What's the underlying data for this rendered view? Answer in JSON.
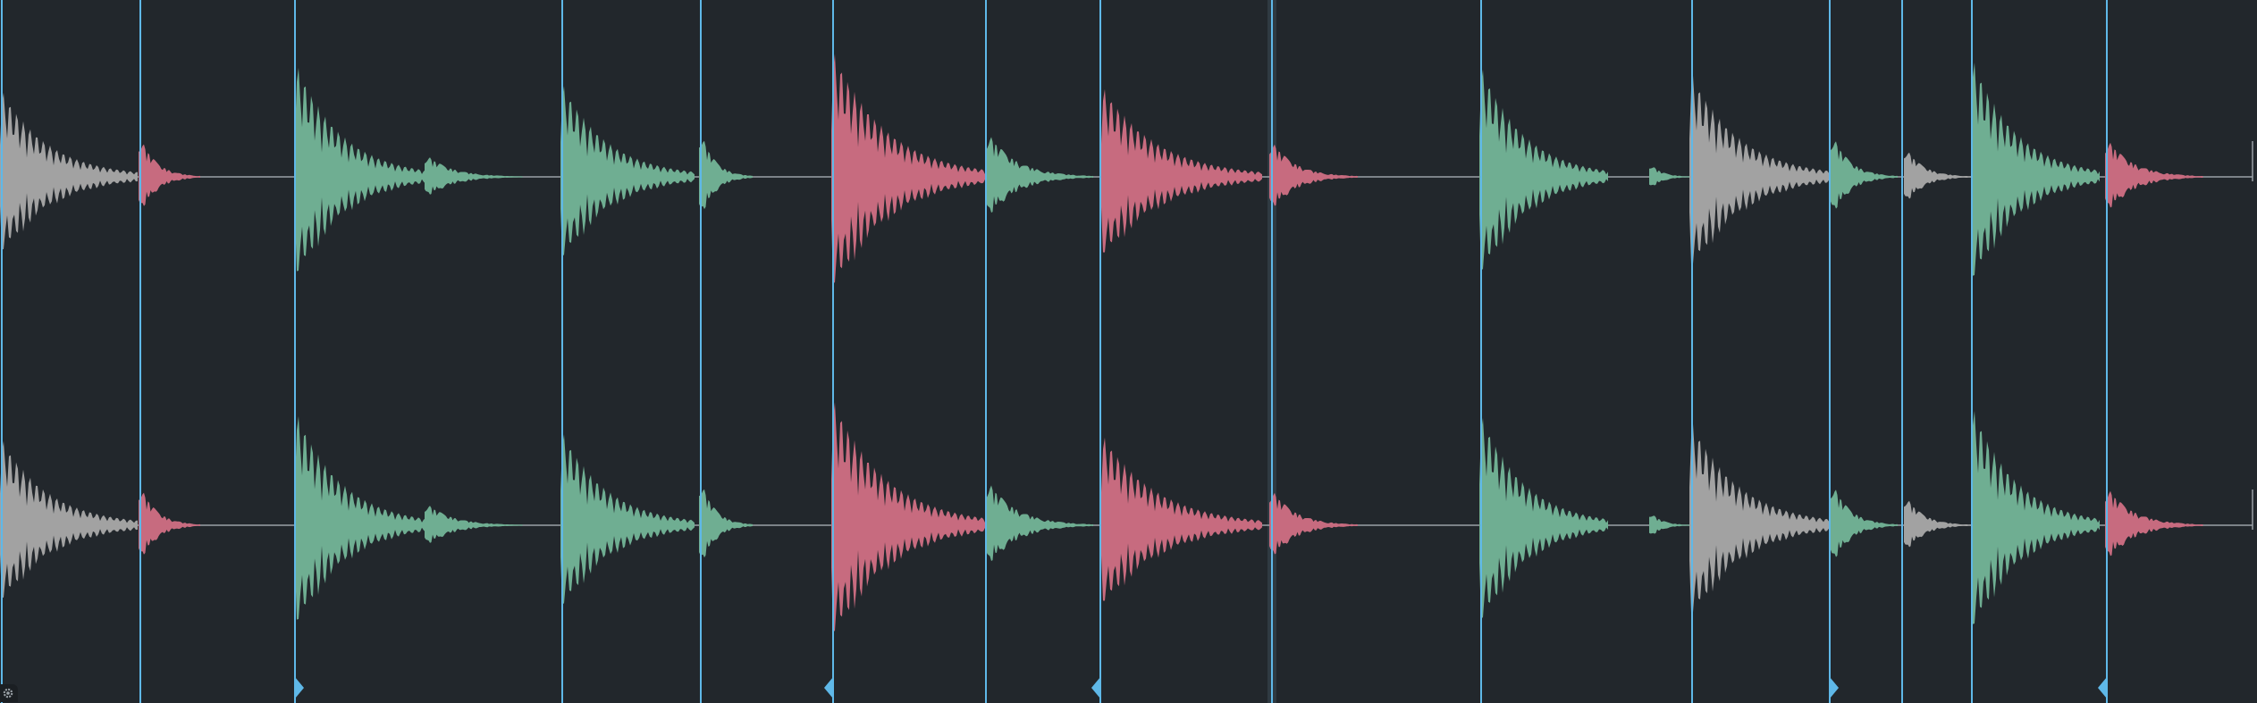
{
  "app": {
    "view": "waveform-slice-editor"
  },
  "colors": {
    "background": "#22272c",
    "marker": "#5fb8e8",
    "centerline": "#9aa1a7",
    "gray": "#a2a2a2",
    "green": "#6fae92",
    "red": "#c76b7f",
    "selected_band": "#2f3a42"
  },
  "channels": [
    "left",
    "right"
  ],
  "hits": [
    {
      "color": "gray",
      "amp": 0.6,
      "len": 155,
      "ring": true
    },
    {
      "color": "red",
      "amp": 0.3,
      "len": 70,
      "ring": false
    },
    {
      "color": "green",
      "amp": 0.78,
      "len": 150,
      "ring": true
    },
    {
      "color": "green",
      "amp": 0.16,
      "len": 110,
      "ring": false
    },
    {
      "color": "green",
      "amp": 0.65,
      "len": 150,
      "ring": true
    },
    {
      "color": "green",
      "amp": 0.35,
      "len": 60,
      "ring": false
    },
    {
      "color": "red",
      "amp": 0.87,
      "len": 175,
      "ring": true
    },
    {
      "color": "green",
      "amp": 0.32,
      "len": 120,
      "ring": false
    },
    {
      "color": "red",
      "amp": 0.62,
      "len": 180,
      "ring": true
    },
    {
      "color": "red",
      "amp": 0.27,
      "len": 100,
      "ring": false
    },
    {
      "color": "green",
      "amp": 0.77,
      "len": 145,
      "ring": true
    },
    {
      "color": "green",
      "amp": 0.1,
      "len": 50,
      "ring": false
    },
    {
      "color": "gray",
      "amp": 0.72,
      "len": 160,
      "ring": true
    },
    {
      "color": "green",
      "amp": 0.32,
      "len": 75,
      "ring": false
    },
    {
      "color": "gray",
      "amp": 0.22,
      "len": 75,
      "ring": false
    },
    {
      "color": "green",
      "amp": 0.82,
      "len": 145,
      "ring": true
    },
    {
      "color": "red",
      "amp": 0.28,
      "len": 110,
      "ring": false
    }
  ],
  "slice_markers": [
    {
      "has_flag": false,
      "flag_dir": ""
    },
    {
      "has_flag": false,
      "flag_dir": ""
    },
    {
      "has_flag": true,
      "flag_dir": "right"
    },
    {
      "has_flag": false,
      "flag_dir": ""
    },
    {
      "has_flag": false,
      "flag_dir": ""
    },
    {
      "has_flag": true,
      "flag_dir": "left"
    },
    {
      "has_flag": false,
      "flag_dir": ""
    },
    {
      "has_flag": true,
      "flag_dir": "left"
    },
    {
      "has_flag": false,
      "flag_dir": ""
    },
    {
      "has_flag": false,
      "flag_dir": ""
    },
    {
      "has_flag": false,
      "flag_dir": ""
    },
    {
      "has_flag": true,
      "flag_dir": "right"
    },
    {
      "has_flag": false,
      "flag_dir": ""
    },
    {
      "has_flag": false,
      "flag_dir": ""
    },
    {
      "has_flag": true,
      "flag_dir": "left"
    }
  ],
  "settings_icon": "gear-icon"
}
